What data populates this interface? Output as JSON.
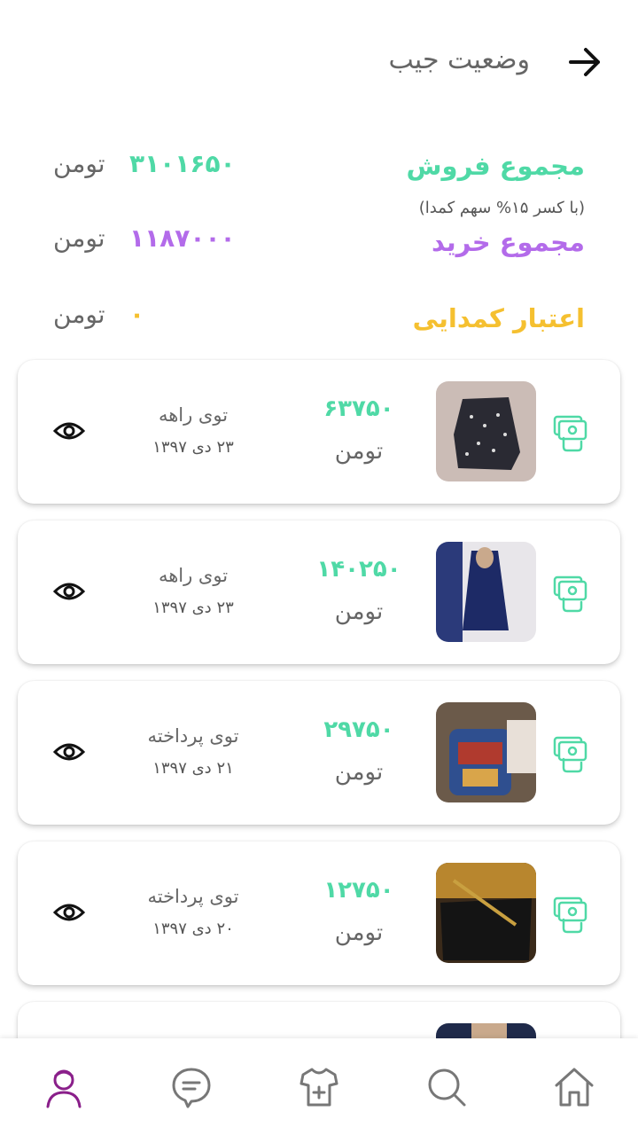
{
  "header": {
    "title": "وضعیت جیب",
    "back_icon": "arrow-right-icon"
  },
  "summary": {
    "sales": {
      "label": "مجموع فروش",
      "note": "(با کسر ۱۵% سهم کمدا)",
      "value": "۳۱۰۱۶۵۰",
      "unit": "تومن"
    },
    "purchases": {
      "label": "مجموع خرید",
      "value": "۱۱۸۷۰۰۰",
      "unit": "تومن"
    },
    "credit": {
      "label": "اعتبار کمدایی",
      "value": "۰",
      "unit": "تومن"
    }
  },
  "transactions": [
    {
      "price": "۶۳۷۵۰",
      "unit": "تومن",
      "status": "توی راهه",
      "date": "۲۳ دی ۱۳۹۷"
    },
    {
      "price": "۱۴۰۲۵۰",
      "unit": "تومن",
      "status": "توی راهه",
      "date": "۲۳ دی ۱۳۹۷"
    },
    {
      "price": "۲۹۷۵۰",
      "unit": "تومن",
      "status": "توی پرداخته",
      "date": "۲۱ دی ۱۳۹۷"
    },
    {
      "price": "۱۲۷۵۰",
      "unit": "تومن",
      "status": "توی پرداخته",
      "date": "۲۰ دی ۱۳۹۷"
    }
  ],
  "colors": {
    "sales": "#4fd9a6",
    "purchases": "#b36bea",
    "credit": "#f5c030",
    "nav_active": "#8a1f8a"
  },
  "bottom_nav": [
    "profile-icon",
    "chat-icon",
    "add-clothing-icon",
    "search-icon",
    "home-icon"
  ]
}
